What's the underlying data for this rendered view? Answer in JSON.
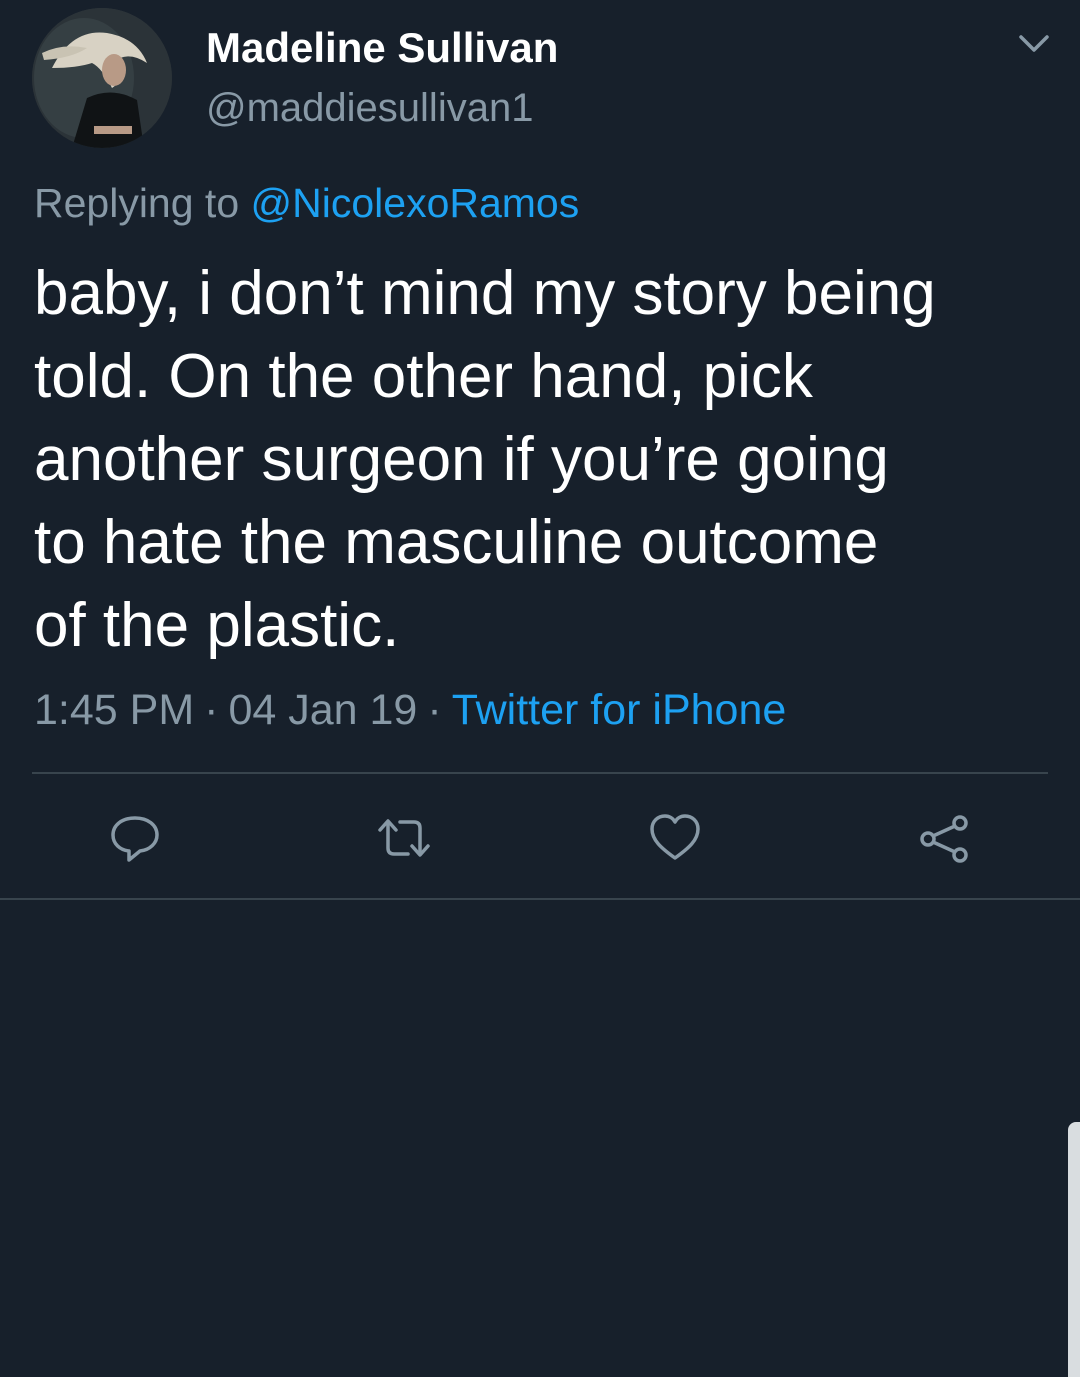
{
  "tweet": {
    "display_name": "Madeline Sullivan",
    "handle": "@maddiesullivan1",
    "reply_prefix": "Replying to ",
    "reply_to": "@NicolexoRamos",
    "text": "baby, i don’t mind my story being\ntold. On the other hand, pick\nanother surgeon if you’re going\nto hate the masculine outcome\nof the plastic.",
    "time": "1:45 PM",
    "separator": "·",
    "date": "04 Jan 19",
    "source": "Twitter for iPhone"
  },
  "icons": {
    "caret": "chevron-down-icon",
    "reply": "comment-icon",
    "retweet": "retweet-icon",
    "like": "heart-icon",
    "share": "share-icon"
  },
  "colors": {
    "background": "#17202b",
    "secondary_text": "#8899a6",
    "accent": "#1da1f2",
    "divider": "#38444d"
  }
}
